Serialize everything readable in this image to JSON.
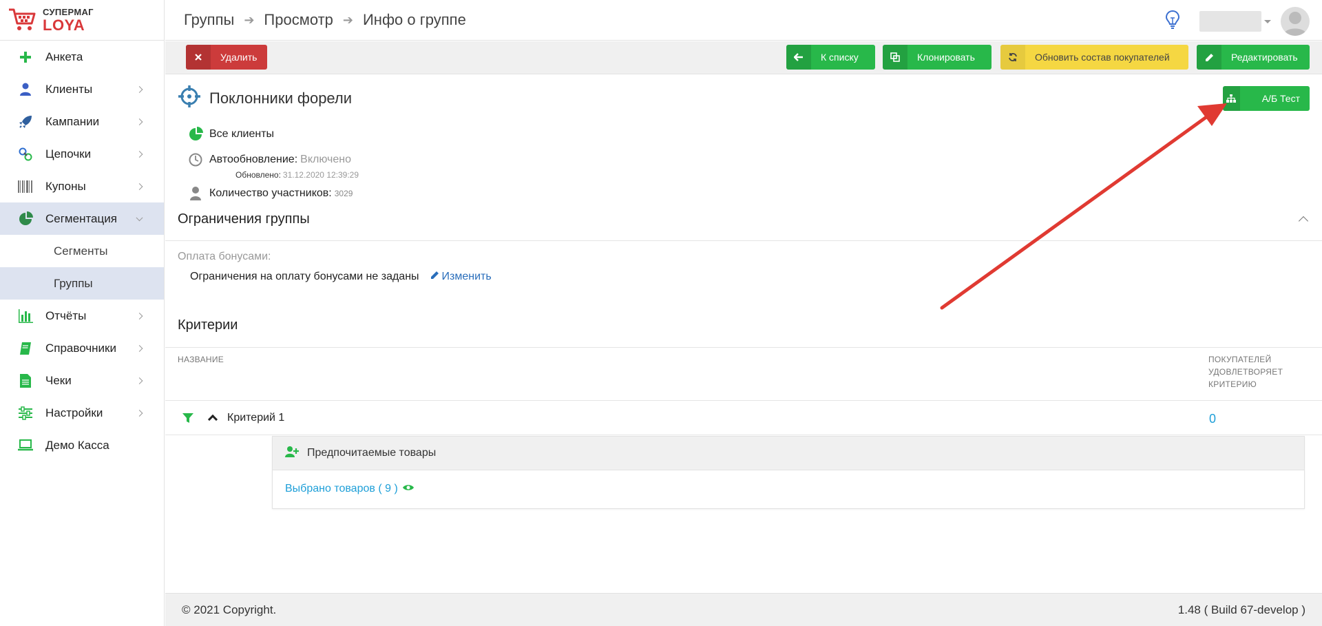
{
  "brand": {
    "line1": "СУПЕРМАГ",
    "line2": "LOYA"
  },
  "breadcrumb": [
    "Группы",
    "Просмотр",
    "Инфо о группе"
  ],
  "sidebar": {
    "items": [
      {
        "label": "Анкета",
        "icon": "plus-icon"
      },
      {
        "label": "Клиенты",
        "icon": "user-icon"
      },
      {
        "label": "Кампании",
        "icon": "rocket-icon"
      },
      {
        "label": "Цепочки",
        "icon": "chain-icon"
      },
      {
        "label": "Купоны",
        "icon": "barcode-icon"
      },
      {
        "label": "Сегментация",
        "icon": "pie-icon"
      },
      {
        "label": "Сегменты"
      },
      {
        "label": "Группы"
      },
      {
        "label": "Отчёты",
        "icon": "bar-chart-icon"
      },
      {
        "label": "Справочники",
        "icon": "book-icon"
      },
      {
        "label": "Чеки",
        "icon": "receipt-icon"
      },
      {
        "label": "Настройки",
        "icon": "sliders-icon"
      },
      {
        "label": "Демо Касса",
        "icon": "laptop-icon"
      }
    ]
  },
  "toolbar": {
    "delete": "Удалить",
    "to_list": "К списку",
    "clone": "Клонировать",
    "refresh": "Обновить состав покупателей",
    "edit": "Редактировать"
  },
  "group": {
    "title": "Поклонники форели",
    "ab_test": "А/Б Тест",
    "all_clients": "Все клиенты",
    "autoupdate_label": "Автообновление:",
    "autoupdate_value": "Включено",
    "updated_label": "Обновлено:",
    "updated_value": "31.12.2020 12:39:29",
    "members_label": "Количество участников:",
    "members_value": "3029"
  },
  "limits": {
    "title": "Ограничения группы",
    "bonus_label": "Оплата бонусами:",
    "bonus_text": "Ограничения на оплату бонусами не заданы",
    "change": "Изменить"
  },
  "criteria": {
    "title": "Критерии",
    "col_name": "НАЗВАНИЕ",
    "col_count_1": "ПОКУПАТЕЛЕЙ",
    "col_count_2": "УДОВЛЕТВОРЯЕТ",
    "col_count_3": "КРИТЕРИЮ",
    "row_name": "Критерий 1",
    "row_count": "0",
    "card_title": "Предпочитаемые товары",
    "card_link": "Выбрано товаров ( 9 )"
  },
  "footer": {
    "copyright": "© 2021 Copyright.",
    "version": "1.48 ( Build 67-develop )"
  },
  "colors": {
    "green": "#28b84a",
    "red": "#cc3b3b",
    "yellow": "#f5d742",
    "arrow": "#e03a32",
    "link": "#1e9fd8"
  }
}
